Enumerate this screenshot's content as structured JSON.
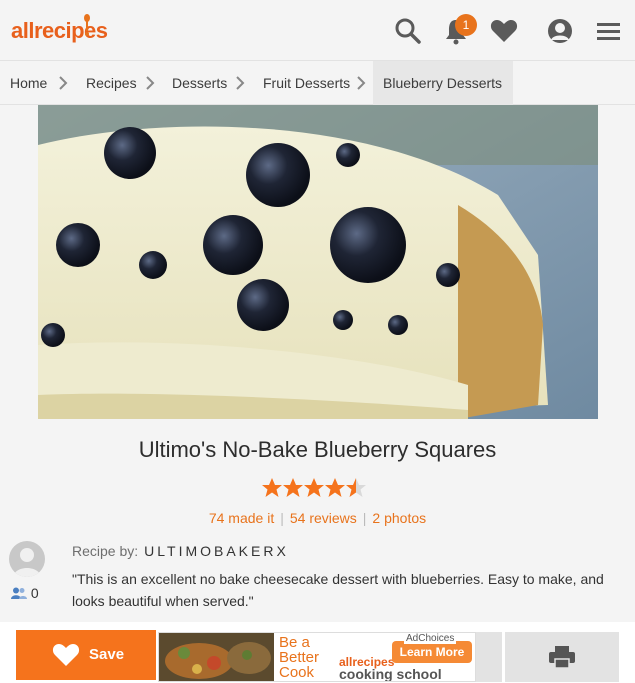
{
  "header": {
    "logo_text": "allrecipes",
    "notification_count": "1",
    "icons": [
      "search-icon",
      "bell-icon",
      "heart-icon",
      "profile-icon",
      "menu-icon"
    ],
    "accent_color": "#e8731c"
  },
  "breadcrumb": {
    "items": [
      {
        "label": "Home"
      },
      {
        "label": "Recipes"
      },
      {
        "label": "Desserts"
      },
      {
        "label": "Fruit Desserts"
      },
      {
        "label": "Blueberry Desserts"
      }
    ]
  },
  "recipe": {
    "title": "Ultimo's No-Bake Blueberry Squares",
    "rating": 4.5,
    "rating_max": 5,
    "made_it": "74 made it",
    "reviews": "54 reviews",
    "photos": "2 photos",
    "recipe_by_label": "Recipe by:",
    "author": "ULTIMOBAKERX",
    "followers": "0",
    "description": "\"This is an excellent no bake cheesecake dessert with blueberries. Easy to make, and looks beautiful when served.\""
  },
  "bottom_bar": {
    "save_label": "Save",
    "ad": {
      "text_line1": "Be a",
      "text_line2": "Better",
      "text_line3": "Cook",
      "brand": "allrecipes",
      "brand_sub": "cooking school",
      "cta": "Learn More",
      "adchoices": "AdChoices"
    }
  }
}
